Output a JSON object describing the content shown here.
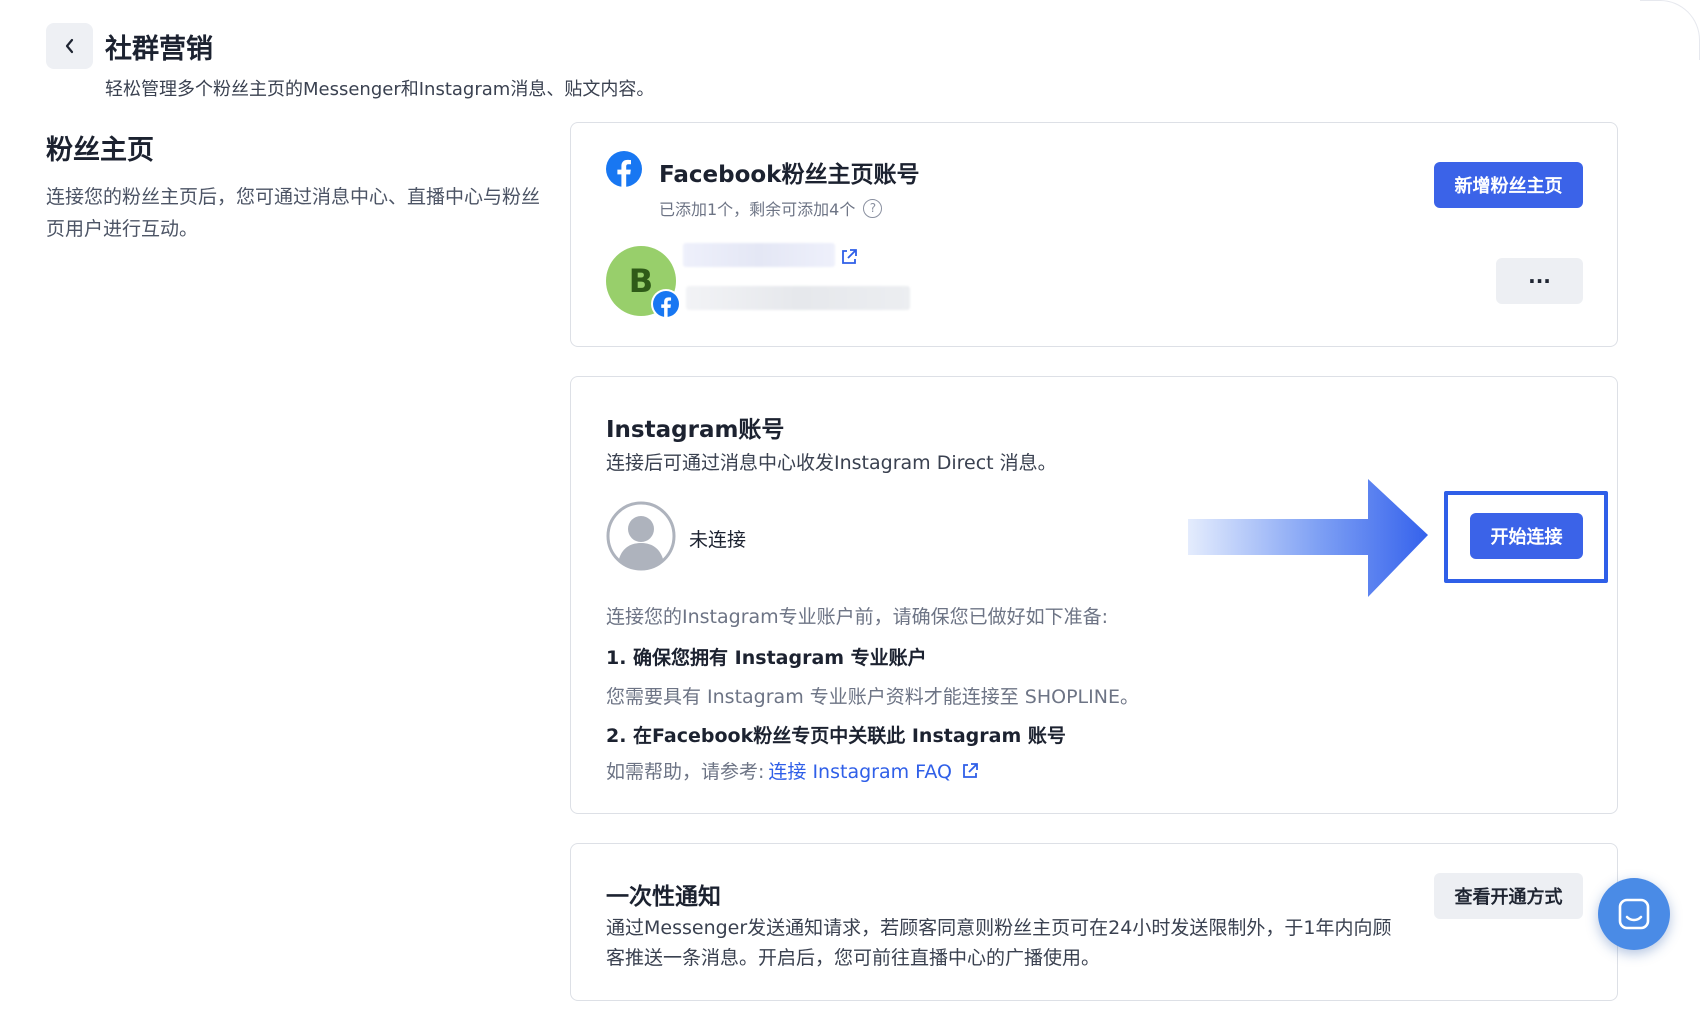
{
  "header": {
    "title": "社群营销",
    "subtitle": "轻松管理多个粉丝主页的Messenger和Instagram消息、贴文内容。",
    "back_icon": "chevron-left-icon"
  },
  "section": {
    "title": "粉丝主页",
    "description": "连接您的粉丝主页后，您可通过消息中心、直播中心与粉丝页用户进行互动。"
  },
  "facebook_card": {
    "icon": "facebook-icon",
    "title": "Facebook粉丝主页账号",
    "usage": "已添加1个，剩余可添加4个",
    "add_button": "新增粉丝主页",
    "page_avatar_letter": "B",
    "more_button": "···"
  },
  "instagram_card": {
    "title": "Instagram账号",
    "subtitle": "连接后可通过消息中心收发Instagram Direct 消息。",
    "status": "未连接",
    "connect_button": "开始连接",
    "prep_lead": "连接您的Instagram专业账户前，请确保您已做好如下准备:",
    "step1_title": "1. 确保您拥有 Instagram 专业账户",
    "step1_desc": "您需要具有 Instagram 专业账户资料才能连接至 SHOPLINE。",
    "step2_title": "2. 在Facebook粉丝专页中关联此 Instagram 账号",
    "step2_help_prefix": "如需帮助，请参考:",
    "step2_help_link": "连接 Instagram FAQ"
  },
  "otn_card": {
    "title": "一次性通知",
    "description": "通过Messenger发送通知请求，若顾客同意则粉丝主页可在24小时发送限制外，于1年内向顾客推送一条消息。开启后，您可前往直播中心的广播使用。",
    "view_button": "查看开通方式"
  },
  "colors": {
    "primary": "#3b63e8",
    "facebook": "#1877f2",
    "highlight": "#2f5fe8"
  }
}
